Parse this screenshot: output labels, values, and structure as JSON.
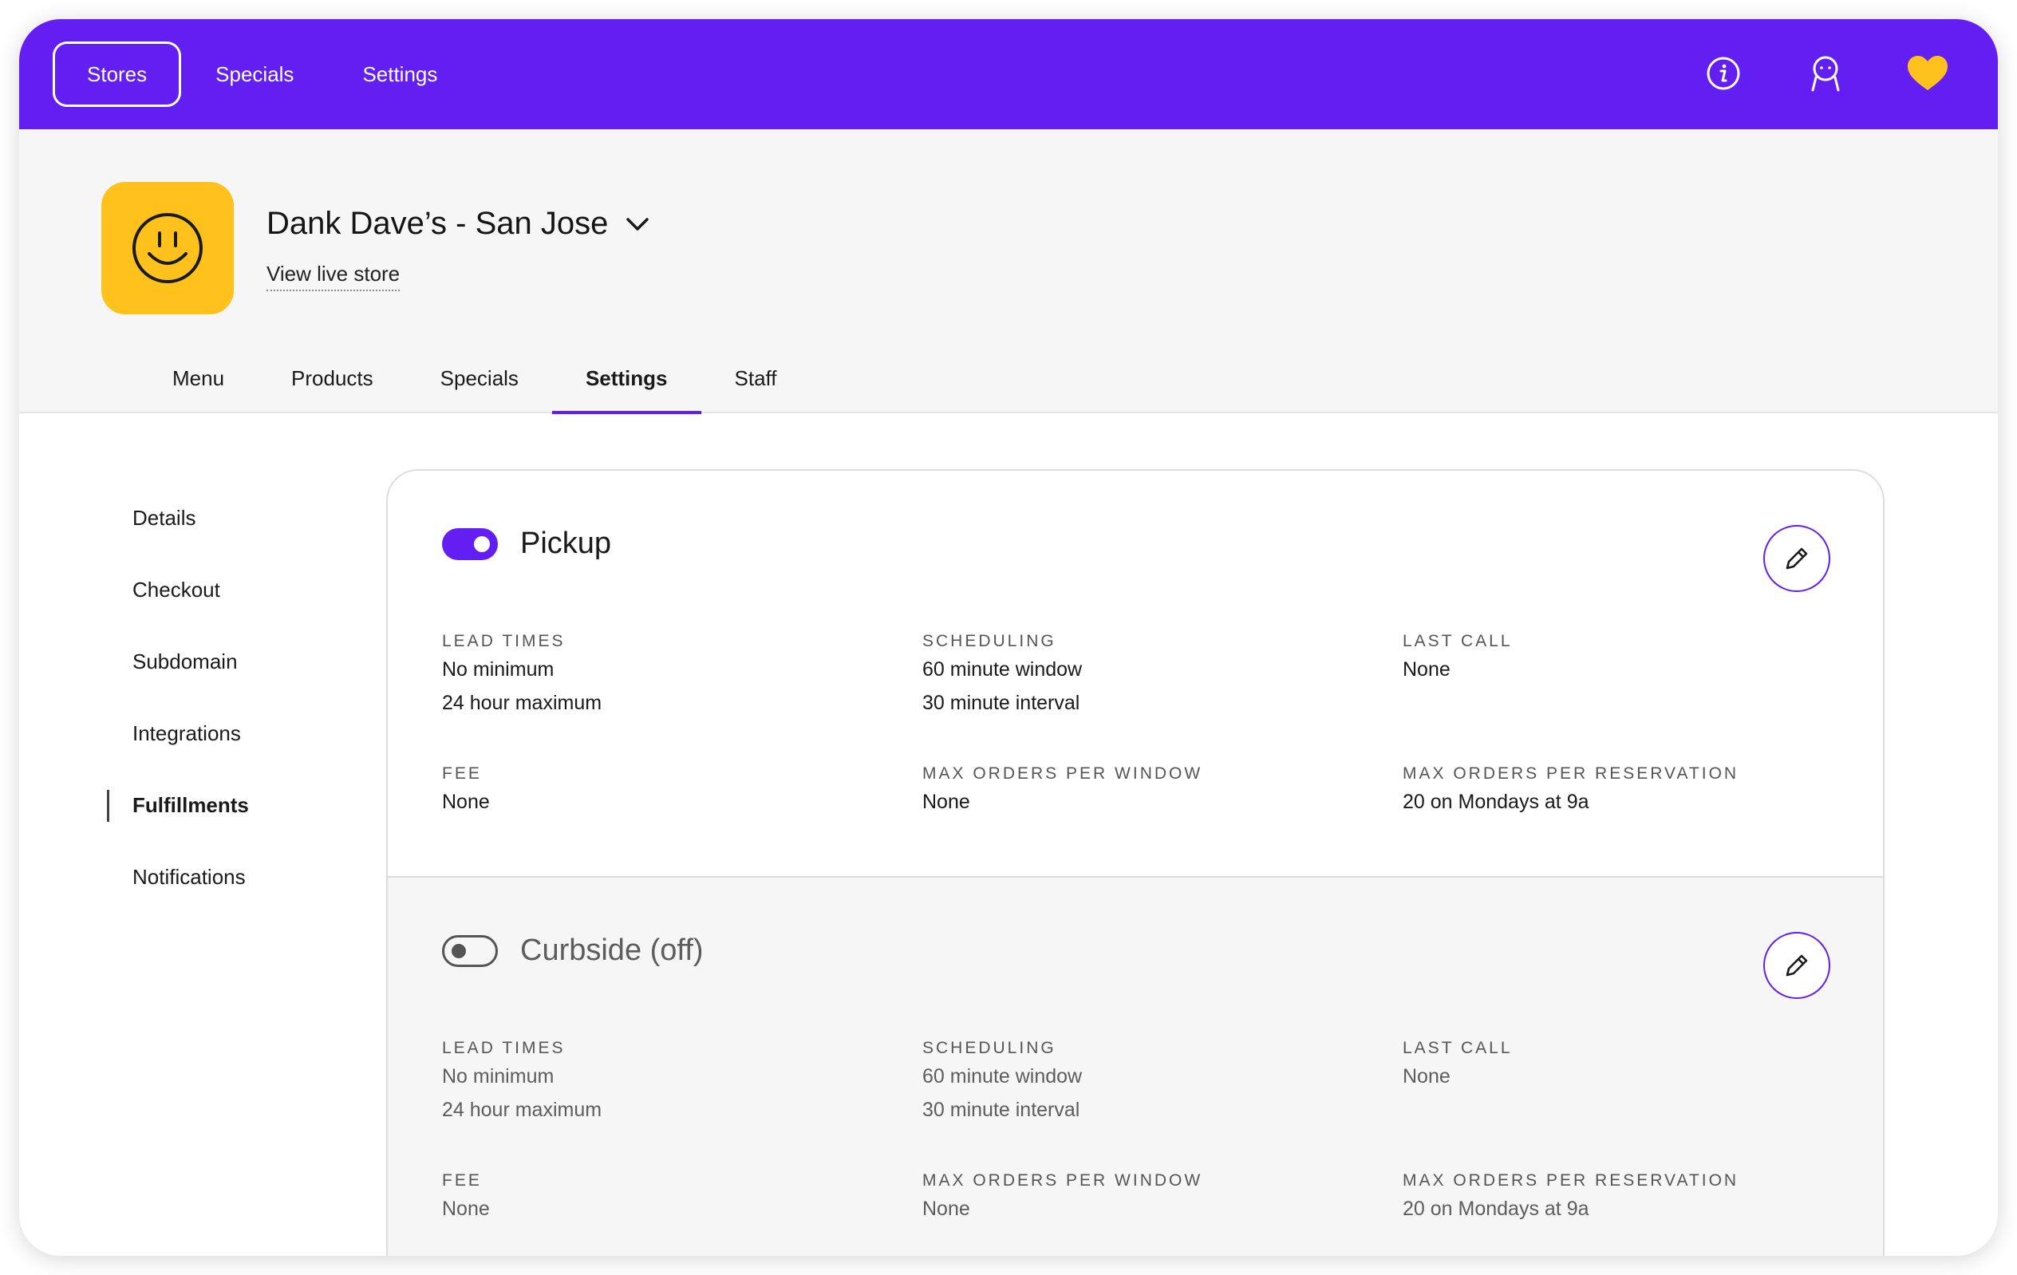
{
  "topnav": {
    "items": [
      {
        "label": "Stores",
        "active": true
      },
      {
        "label": "Specials",
        "active": false
      },
      {
        "label": "Settings",
        "active": false
      }
    ],
    "icons": [
      "info-icon",
      "profile-icon",
      "heart-icon"
    ]
  },
  "store": {
    "name": "Dank Dave’s - San Jose",
    "view_live": "View live store"
  },
  "subnav": {
    "items": [
      {
        "label": "Menu",
        "active": false
      },
      {
        "label": "Products",
        "active": false
      },
      {
        "label": "Specials",
        "active": false
      },
      {
        "label": "Settings",
        "active": true
      },
      {
        "label": "Staff",
        "active": false
      }
    ]
  },
  "sidemenu": {
    "items": [
      {
        "label": "Details",
        "active": false
      },
      {
        "label": "Checkout",
        "active": false
      },
      {
        "label": "Subdomain",
        "active": false
      },
      {
        "label": "Integrations",
        "active": false
      },
      {
        "label": "Fulfillments",
        "active": true
      },
      {
        "label": "Notifications",
        "active": false
      }
    ]
  },
  "fulfillments": [
    {
      "title": "Pickup",
      "enabled": true,
      "lead_times_label": "LEAD TIMES",
      "lead_times": [
        "No minimum",
        "24 hour maximum"
      ],
      "scheduling_label": "SCHEDULING",
      "scheduling": [
        "60 minute window",
        "30 minute interval"
      ],
      "last_call_label": "LAST CALL",
      "last_call": "None",
      "fee_label": "FEE",
      "fee": "None",
      "max_window_label": "MAX ORDERS PER WINDOW",
      "max_window": "None",
      "max_reservation_label": "MAX ORDERS PER RESERVATION",
      "max_reservation": "20 on Mondays at 9a"
    },
    {
      "title": "Curbside (off)",
      "enabled": false,
      "lead_times_label": "LEAD TIMES",
      "lead_times": [
        "No minimum",
        "24 hour maximum"
      ],
      "scheduling_label": "SCHEDULING",
      "scheduling": [
        "60 minute window",
        "30 minute interval"
      ],
      "last_call_label": "LAST CALL",
      "last_call": "None",
      "fee_label": "FEE",
      "fee": "None",
      "max_window_label": "MAX ORDERS PER WINDOW",
      "max_window": "None",
      "max_reservation_label": "MAX ORDERS PER RESERVATION",
      "max_reservation": "20 on Mondays at 9a"
    }
  ],
  "colors": {
    "brand": "#631ff2",
    "logo_bg": "#ffc21d",
    "heart": "#ffc21d"
  }
}
